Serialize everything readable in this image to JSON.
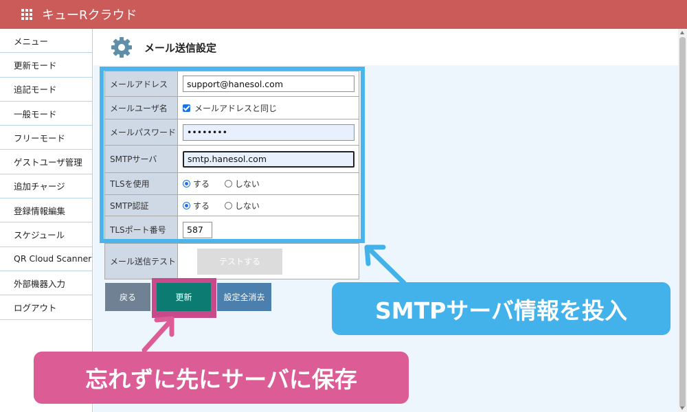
{
  "header": {
    "app_title": "キューRクラウド",
    "apps_icon": "apps-grid-icon"
  },
  "sidebar": {
    "items": [
      {
        "label": "メニュー"
      },
      {
        "label": "更新モード"
      },
      {
        "label": "追記モード"
      },
      {
        "label": "一般モード"
      },
      {
        "label": "フリーモード"
      },
      {
        "label": "ゲストユーザ管理"
      },
      {
        "label": "追加チャージ"
      },
      {
        "label": "登録情報編集"
      },
      {
        "label": "スケジュール"
      },
      {
        "label": "QR Cloud Scanner"
      },
      {
        "label": "外部機器入力"
      },
      {
        "label": "ログアウト"
      }
    ]
  },
  "page": {
    "title": "メール送信設定",
    "icon": "gear-icon"
  },
  "form": {
    "mail_address": {
      "label": "メールアドレス",
      "value": "support@hanesol.com"
    },
    "mail_user": {
      "label": "メールユーザ名",
      "checkbox_label": "メールアドレスと同じ",
      "checked": true
    },
    "mail_password": {
      "label": "メールパスワード",
      "value": "••••••••"
    },
    "smtp_server": {
      "label": "SMTPサーバ",
      "value": "smtp.hanesol.com"
    },
    "tls": {
      "label": "TLSを使用",
      "option_yes": "する",
      "option_no": "しない",
      "selected": "する"
    },
    "smtp_auth": {
      "label": "SMTP認証",
      "option_yes": "する",
      "option_no": "しない",
      "selected": "する"
    },
    "tls_port": {
      "label": "TLSポート番号",
      "value": "587"
    },
    "mail_test": {
      "label": "メール送信テスト",
      "button_label": "テストする"
    }
  },
  "buttons": {
    "back": "戻る",
    "update": "更新",
    "clear_all": "設定全消去"
  },
  "annotations": {
    "blue_callout": "SMTPサーバ情報を投入",
    "pink_callout": "忘れずに先にサーバに保存"
  },
  "colors": {
    "header": "#cb5b58",
    "highlight_blue": "#43b2ea",
    "highlight_pink": "#dc5c96",
    "update_button": "#0c7b72"
  }
}
